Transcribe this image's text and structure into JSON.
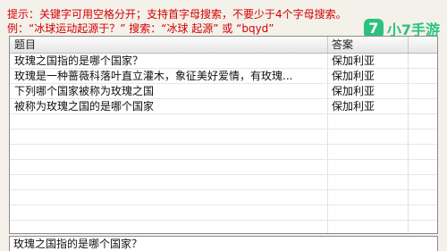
{
  "hint": {
    "line1": "提示：关键字可用空格分开；支持首字母搜索，不要少于4个字母搜索。",
    "line2": "例：“冰球运动起源于？” 搜索：“冰球 起源” 或 “bqyd”"
  },
  "logo": {
    "mark": "7",
    "text": "小7手游"
  },
  "table": {
    "columns": [
      "题目",
      "答案"
    ],
    "rows": [
      {
        "question": "玫瑰之国指的是哪个国家？",
        "answer": "保加利亚"
      },
      {
        "question": "玫瑰是一种蔷薇科落叶直立灌木，象征美好爱情，有玫瑰...",
        "answer": "保加利亚"
      },
      {
        "question": "下列哪个国家被称为玫瑰之国",
        "answer": "保加利亚"
      },
      {
        "question": "被称为玫瑰之国的是哪个国家",
        "answer": "保加利亚"
      }
    ]
  },
  "detail": {
    "text": "玫瑰之国指的是哪个国家？"
  },
  "colors": {
    "hint_text": "#d40000",
    "logo_green": "#21c07a",
    "panel_border": "#8c8c8c"
  }
}
